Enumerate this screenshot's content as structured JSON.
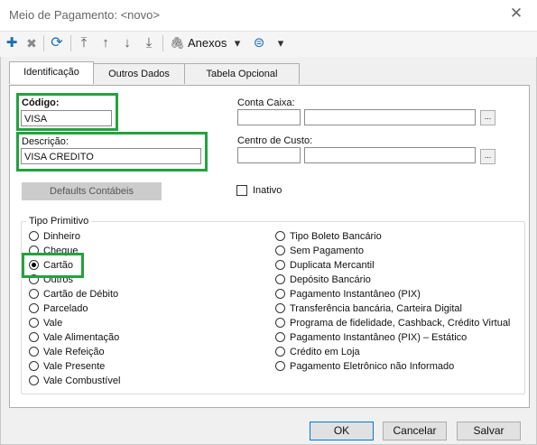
{
  "window": {
    "title": "Meio de Pagamento: <novo>",
    "close_glyph": "✕"
  },
  "toolbar": {
    "add_glyph": "✚",
    "delete_glyph": "✖",
    "refresh_glyph": "⟳",
    "first_glyph": "⤒",
    "up_glyph": "↑",
    "down_glyph": "↓",
    "last_glyph": "⤓",
    "attach_glyph": "🖇",
    "anexos_label": "Anexos",
    "dropdown_glyph": "▾",
    "menu_glyph": "⊜"
  },
  "tabs": [
    {
      "label": "Identificação"
    },
    {
      "label": "Outros Dados"
    },
    {
      "label": "Tabela Opcional"
    }
  ],
  "form": {
    "codigo_label": "Código:",
    "codigo_value": "VISA",
    "descricao_label": "Descrição:",
    "descricao_value": "VISA CREDITO",
    "conta_caixa_label": "Conta Caixa:",
    "centro_custo_label": "Centro de Custo:",
    "ellipsis": "...",
    "defaults_label": "Defaults Contábeis",
    "inativo_label": "Inativo"
  },
  "tipo_primitivo": {
    "title": "Tipo Primitivo",
    "left": [
      "Dinheiro",
      "Cheque",
      "Cartão",
      "Outros",
      "Cartão de Débito",
      "Parcelado",
      "Vale",
      "Vale Alimentação",
      "Vale Refeição",
      "Vale Presente",
      "Vale Combustível"
    ],
    "right": [
      "Tipo Boleto Bancário",
      "Sem Pagamento",
      "Duplicata Mercantil",
      "Depósito Bancário",
      "Pagamento Instantâneo (PIX)",
      "Transferência bancária, Carteira Digital",
      "Programa de fidelidade, Cashback, Crédito Virtual",
      "Pagamento Instantâneo (PIX) – Estático",
      "Crédito em Loja",
      "Pagamento Eletrônico não Informado"
    ],
    "selected": "Cartão"
  },
  "buttons": {
    "ok": "OK",
    "cancel": "Cancelar",
    "save": "Salvar"
  },
  "colors": {
    "highlight": "#23a23f",
    "toolbar_blue": "#1f6fb5"
  }
}
